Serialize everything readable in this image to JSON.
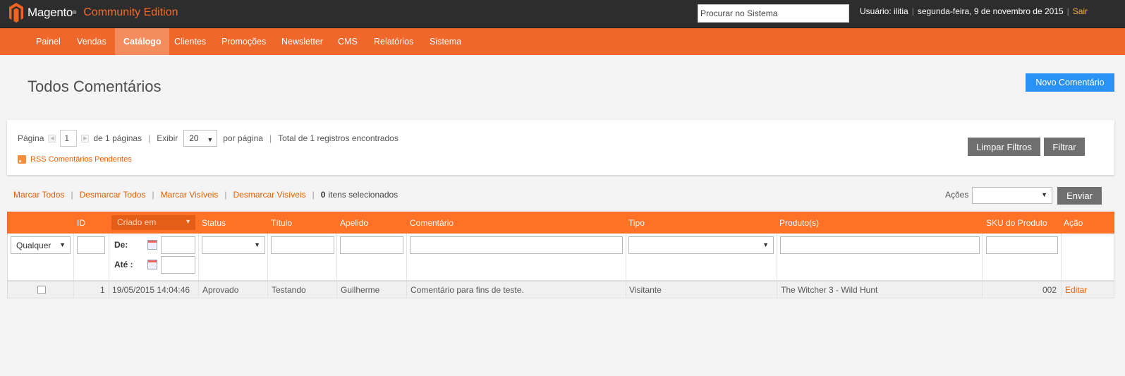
{
  "header": {
    "logo_text": "Magento",
    "logo_tm": "®",
    "edition": "Community Edition",
    "search_placeholder": "Procurar no Sistema",
    "user_text": "Usuário: ilitia",
    "date_text": "segunda-feira, 9 de novembro de 2015",
    "logout_label": "Sair"
  },
  "nav": {
    "items": [
      "Painel",
      "Vendas",
      "Catálogo",
      "Clientes",
      "Promoções",
      "Newsletter",
      "CMS",
      "Relatórios",
      "Sistema"
    ],
    "active": "Catálogo"
  },
  "page": {
    "title": "Todos Comentários",
    "new_button": "Novo Comentário"
  },
  "pager": {
    "page_label": "Página",
    "page_value": "1",
    "of_pages": "de 1 páginas",
    "show_label": "Exibir",
    "per_page_value": "20",
    "per_page_label": "por página",
    "total_text": "Total de 1 registros encontrados",
    "rss_label": "RSS Comentários Pendentes",
    "reset_button": "Limpar Filtros",
    "search_button": "Filtrar"
  },
  "massaction": {
    "select_all": "Marcar Todos",
    "unselect_all": "Desmarcar Todos",
    "select_visible": "Marcar Visíveis",
    "unselect_visible": "Desmarcar Visíveis",
    "selected_count": "0",
    "selected_label": "itens selecionados",
    "actions_label": "Ações",
    "submit_button": "Enviar"
  },
  "grid": {
    "headers": {
      "id": "ID",
      "created": "Criado em",
      "status": "Status",
      "title": "Título",
      "nickname": "Apelido",
      "review": "Comentário",
      "type": "Tipo",
      "product": "Produto(s)",
      "sku": "SKU do Produto",
      "action": "Ação"
    },
    "filter": {
      "any_option": "Qualquer",
      "from_label": "De:",
      "to_label": "Até :"
    },
    "rows": [
      {
        "id": "1",
        "created": "19/05/2015 14:04:46",
        "status": "Aprovado",
        "title": "Testando",
        "nickname": "Guilherme",
        "review": "Comentário para fins de teste.",
        "type": "Visitante",
        "product": "The Witcher 3 - Wild Hunt",
        "sku": "002",
        "action": "Editar"
      }
    ]
  },
  "colors": {
    "header_bg": "#2d2d2d",
    "nav_bg": "#ef672b",
    "nav_active_bg": "#f58c5d",
    "grid_header_bg": "#ff7127",
    "link": "#eb5e00",
    "primary_button": "#2a92f5",
    "secondary_button": "#6f6f6f"
  }
}
